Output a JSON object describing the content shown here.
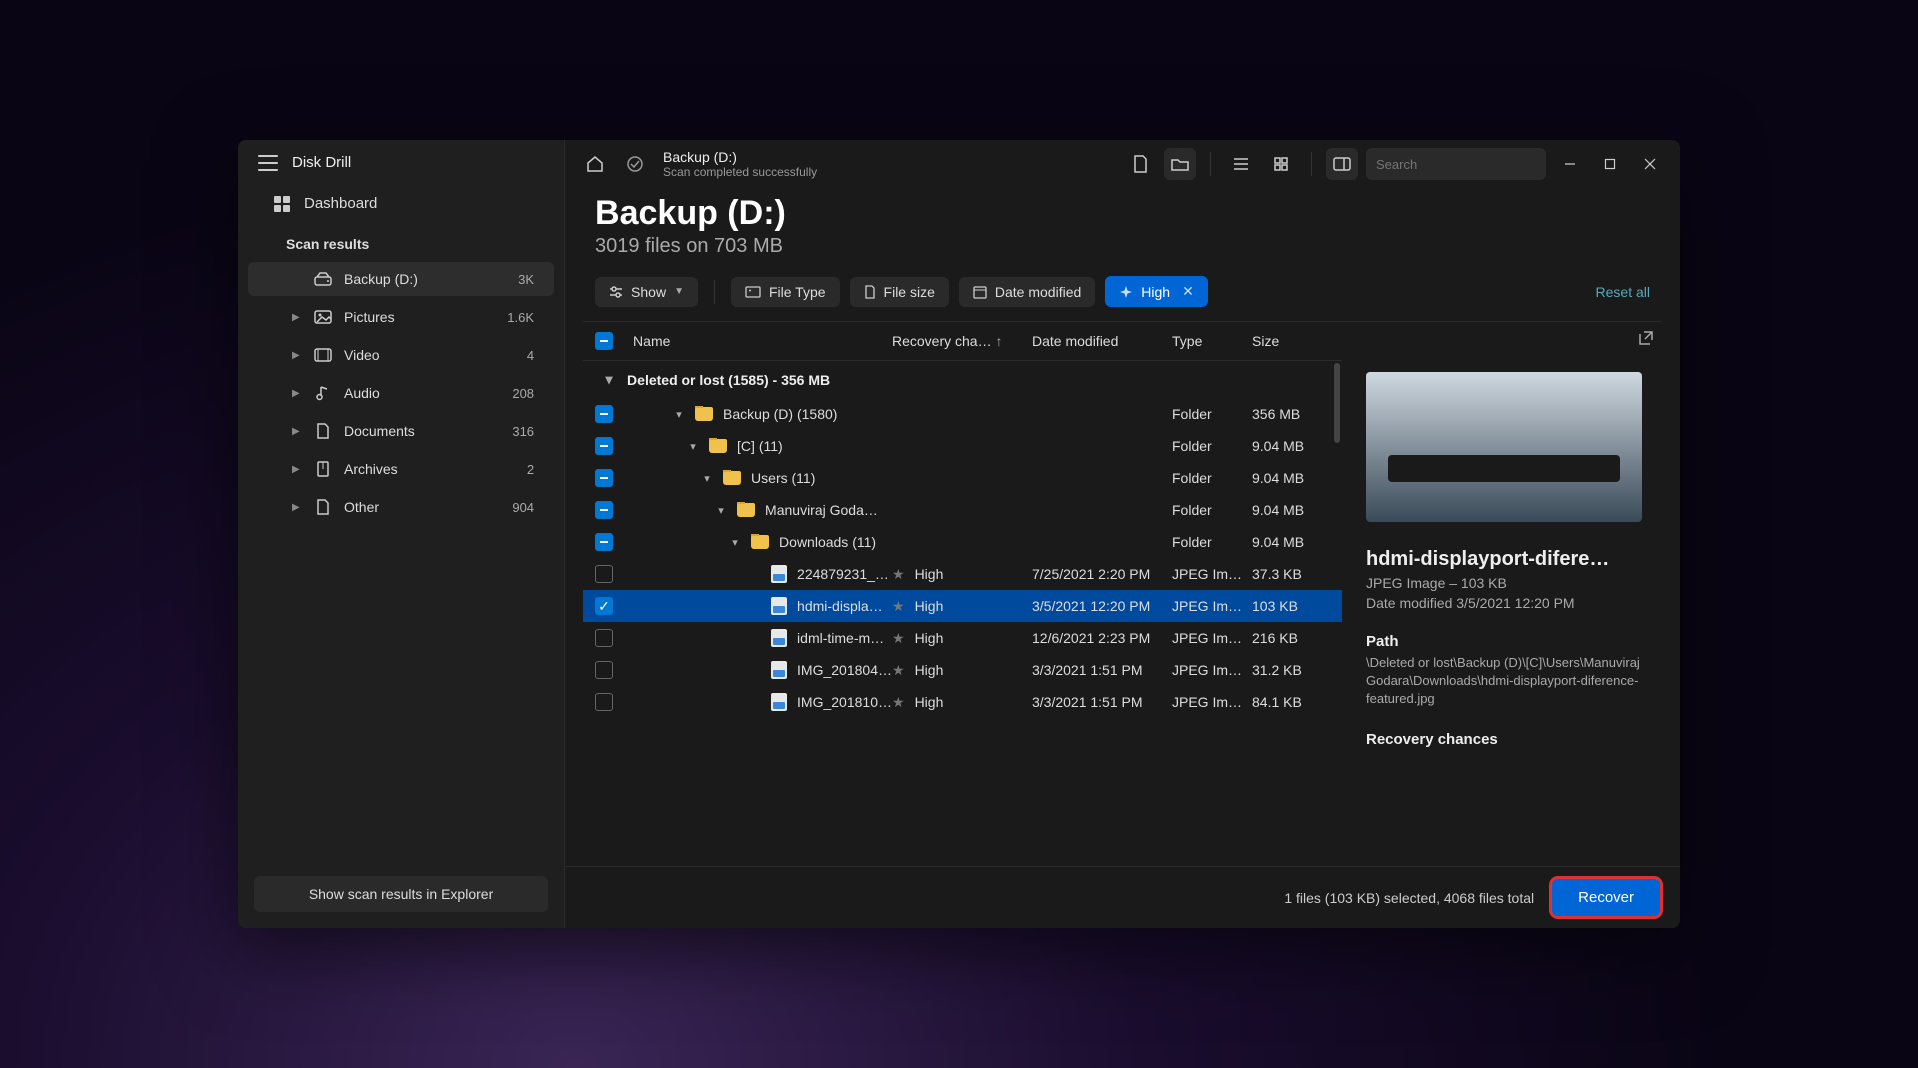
{
  "app": {
    "title": "Disk Drill"
  },
  "sidebar": {
    "dashboard": "Dashboard",
    "section": "Scan results",
    "items": [
      {
        "label": "Backup (D:)",
        "count": "3K",
        "icon": "drive"
      },
      {
        "label": "Pictures",
        "count": "1.6K",
        "icon": "image",
        "expandable": true
      },
      {
        "label": "Video",
        "count": "4",
        "icon": "video",
        "expandable": true
      },
      {
        "label": "Audio",
        "count": "208",
        "icon": "audio",
        "expandable": true
      },
      {
        "label": "Documents",
        "count": "316",
        "icon": "doc",
        "expandable": true
      },
      {
        "label": "Archives",
        "count": "2",
        "icon": "archive",
        "expandable": true
      },
      {
        "label": "Other",
        "count": "904",
        "icon": "other",
        "expandable": true
      }
    ],
    "footer_btn": "Show scan results in Explorer"
  },
  "titlebar": {
    "title": "Backup (D:)",
    "subtitle": "Scan completed successfully",
    "search_placeholder": "Search"
  },
  "header": {
    "title": "Backup (D:)",
    "subtitle": "3019 files on 703 MB"
  },
  "filters": {
    "show": "Show",
    "pills": [
      "File Type",
      "File size",
      "Date modified"
    ],
    "active_pill": "High",
    "reset": "Reset all"
  },
  "columns": {
    "name": "Name",
    "recovery": "Recovery cha…",
    "date": "Date modified",
    "type": "Type",
    "size": "Size"
  },
  "group": {
    "label": "Deleted or lost (1585) - 356 MB"
  },
  "folders": [
    {
      "indent": 0,
      "name": "Backup (D) (1580)",
      "type": "Folder",
      "size": "356 MB",
      "chk": "ind"
    },
    {
      "indent": 1,
      "name": "[C] (11)",
      "type": "Folder",
      "size": "9.04 MB",
      "chk": "ind"
    },
    {
      "indent": 2,
      "name": "Users (11)",
      "type": "Folder",
      "size": "9.04 MB",
      "chk": "ind"
    },
    {
      "indent": 3,
      "name": "Manuviraj Goda…",
      "type": "Folder",
      "size": "9.04 MB",
      "chk": "ind"
    },
    {
      "indent": 4,
      "name": "Downloads (11)",
      "type": "Folder",
      "size": "9.04 MB",
      "chk": "ind"
    }
  ],
  "files": [
    {
      "name": "224879231_…",
      "rec": "High",
      "date": "7/25/2021 2:20 PM",
      "type": "JPEG Im…",
      "size": "37.3 KB",
      "chk": "off"
    },
    {
      "name": "hdmi-displa…",
      "rec": "High",
      "date": "3/5/2021 12:20 PM",
      "type": "JPEG Im…",
      "size": "103 KB",
      "chk": "on",
      "selected": true
    },
    {
      "name": "idml-time-m…",
      "rec": "High",
      "date": "12/6/2021 2:23 PM",
      "type": "JPEG Im…",
      "size": "216 KB",
      "chk": "off"
    },
    {
      "name": "IMG_201804…",
      "rec": "High",
      "date": "3/3/2021 1:51 PM",
      "type": "JPEG Im…",
      "size": "31.2 KB",
      "chk": "off"
    },
    {
      "name": "IMG_201810…",
      "rec": "High",
      "date": "3/3/2021 1:51 PM",
      "type": "JPEG Im…",
      "size": "84.1 KB",
      "chk": "off"
    }
  ],
  "preview": {
    "title": "hdmi-displayport-difere…",
    "meta1": "JPEG Image – 103 KB",
    "meta2": "Date modified 3/5/2021 12:20 PM",
    "path_label": "Path",
    "path": "\\Deleted or lost\\Backup (D)\\[C]\\Users\\Manuviraj Godara\\Downloads\\hdmi-displayport-diference-featured.jpg",
    "rec_label": "Recovery chances"
  },
  "footer": {
    "status": "1 files (103 KB) selected, 4068 files total",
    "recover": "Recover"
  }
}
